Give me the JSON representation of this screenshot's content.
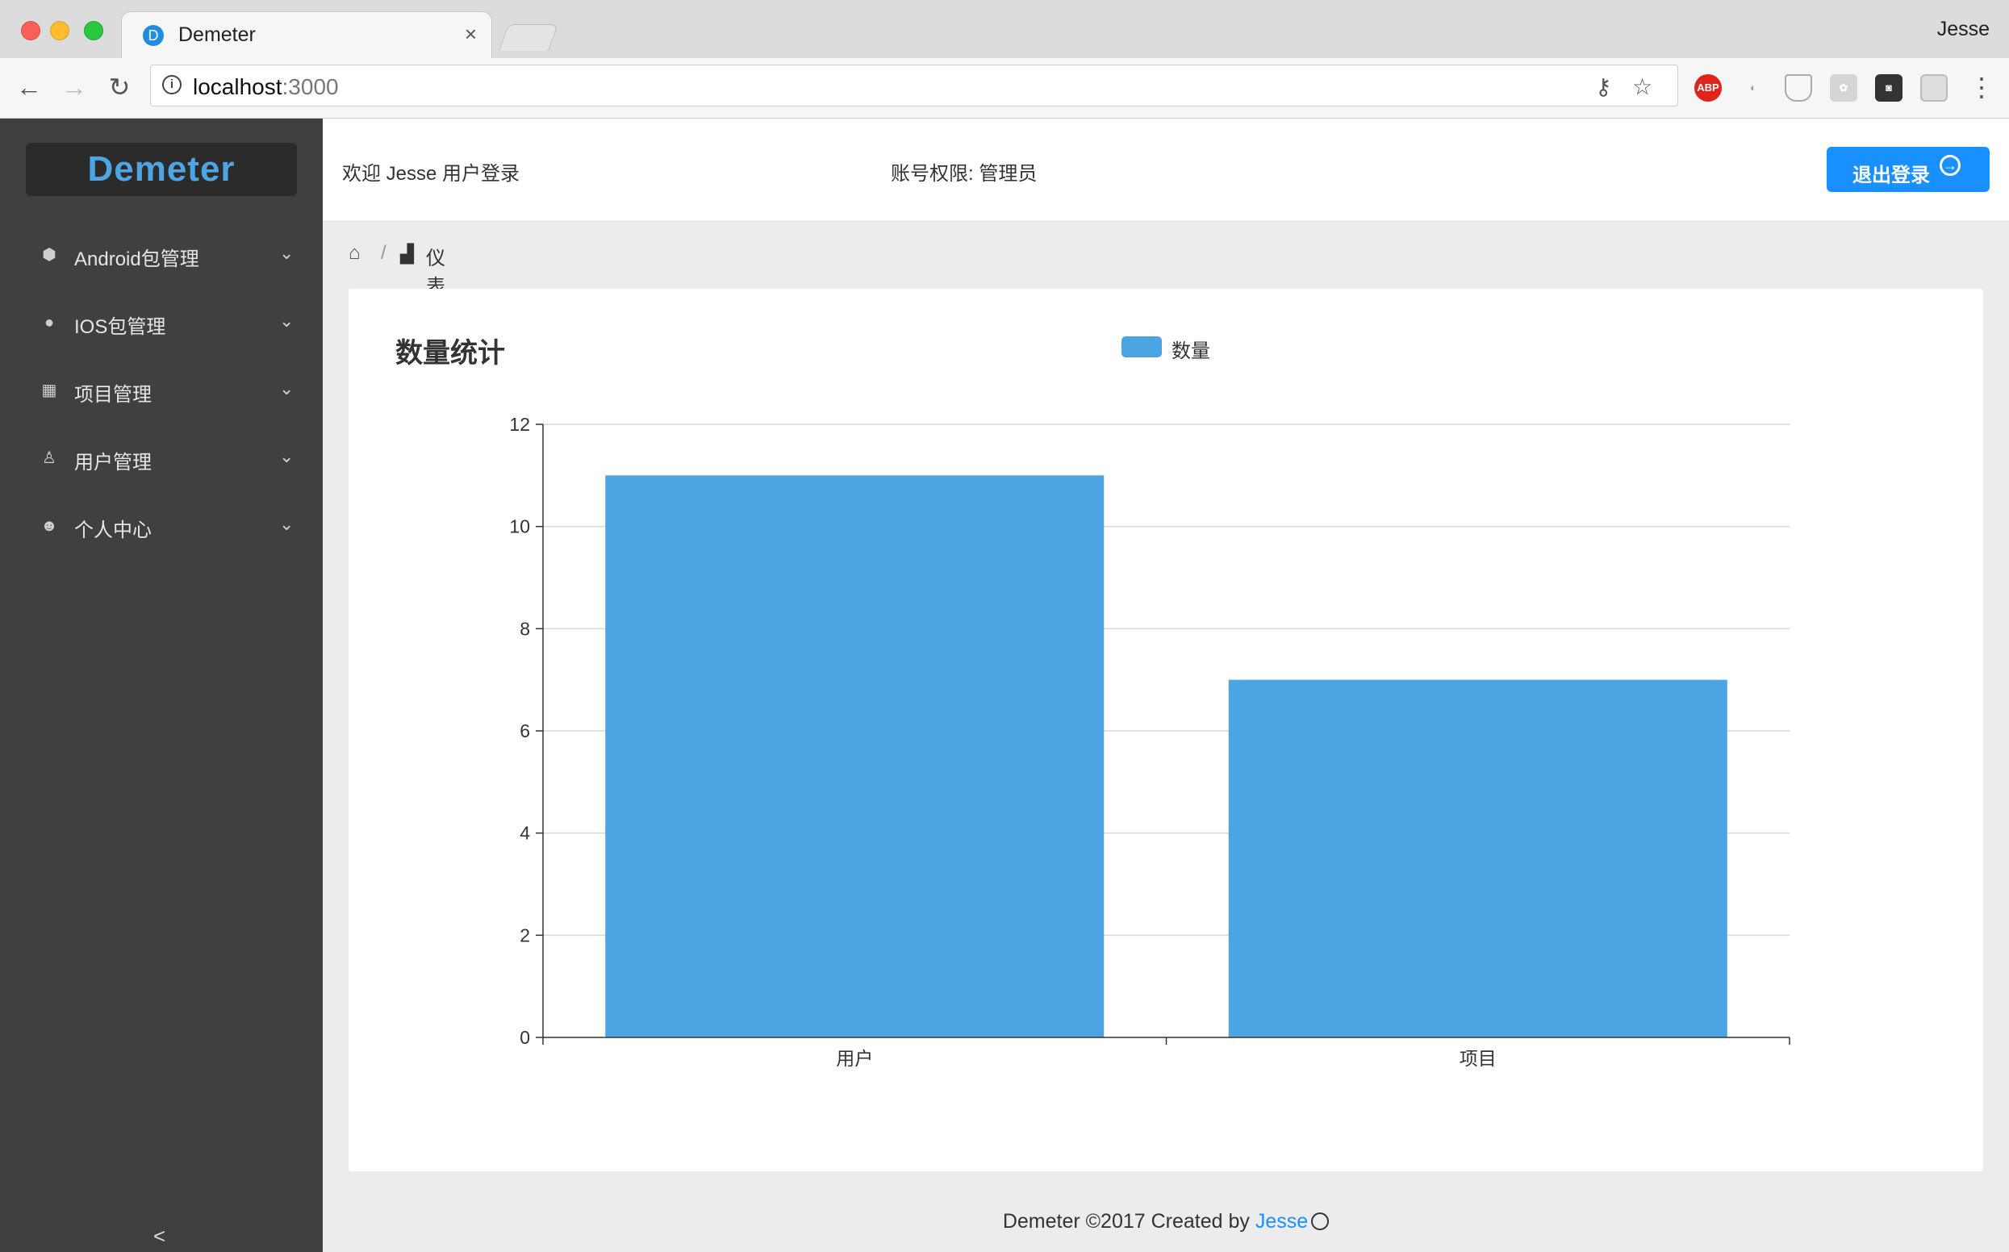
{
  "browser": {
    "tab_title": "Demeter",
    "tab_favicon_letter": "D",
    "profile_name": "Jesse",
    "url_host": "localhost",
    "url_port": ":3000"
  },
  "sidebar": {
    "logo": "Demeter",
    "items": [
      {
        "label": "Android包管理",
        "icon": "android-icon"
      },
      {
        "label": "IOS包管理",
        "icon": "apple-icon"
      },
      {
        "label": "项目管理",
        "icon": "grid-icon"
      },
      {
        "label": "用户管理",
        "icon": "user-icon"
      },
      {
        "label": "个人中心",
        "icon": "smile-icon"
      }
    ],
    "collapse_glyph": "<"
  },
  "header": {
    "welcome": "欢迎 Jesse 用户登录",
    "permission": "账号权限: 管理员",
    "logout_label": "退出登录"
  },
  "breadcrumb": {
    "separator": "/",
    "current": "仪表盘"
  },
  "card": {
    "title": "数量统计"
  },
  "chart_data": {
    "type": "bar",
    "categories": [
      "用户",
      "项目"
    ],
    "series": [
      {
        "name": "数量",
        "values": [
          11,
          7
        ],
        "color": "#4da4e3"
      }
    ],
    "ylim": [
      0,
      12
    ],
    "yticks": [
      0,
      2,
      4,
      6,
      8,
      10,
      12
    ],
    "grid": true,
    "legend": "top-center"
  },
  "footer": {
    "text": "Demeter ©2017 Created by ",
    "author": "Jesse"
  },
  "colors": {
    "sidebar_bg": "#404040",
    "primary": "#1890ff",
    "bar": "#4da4e3"
  }
}
